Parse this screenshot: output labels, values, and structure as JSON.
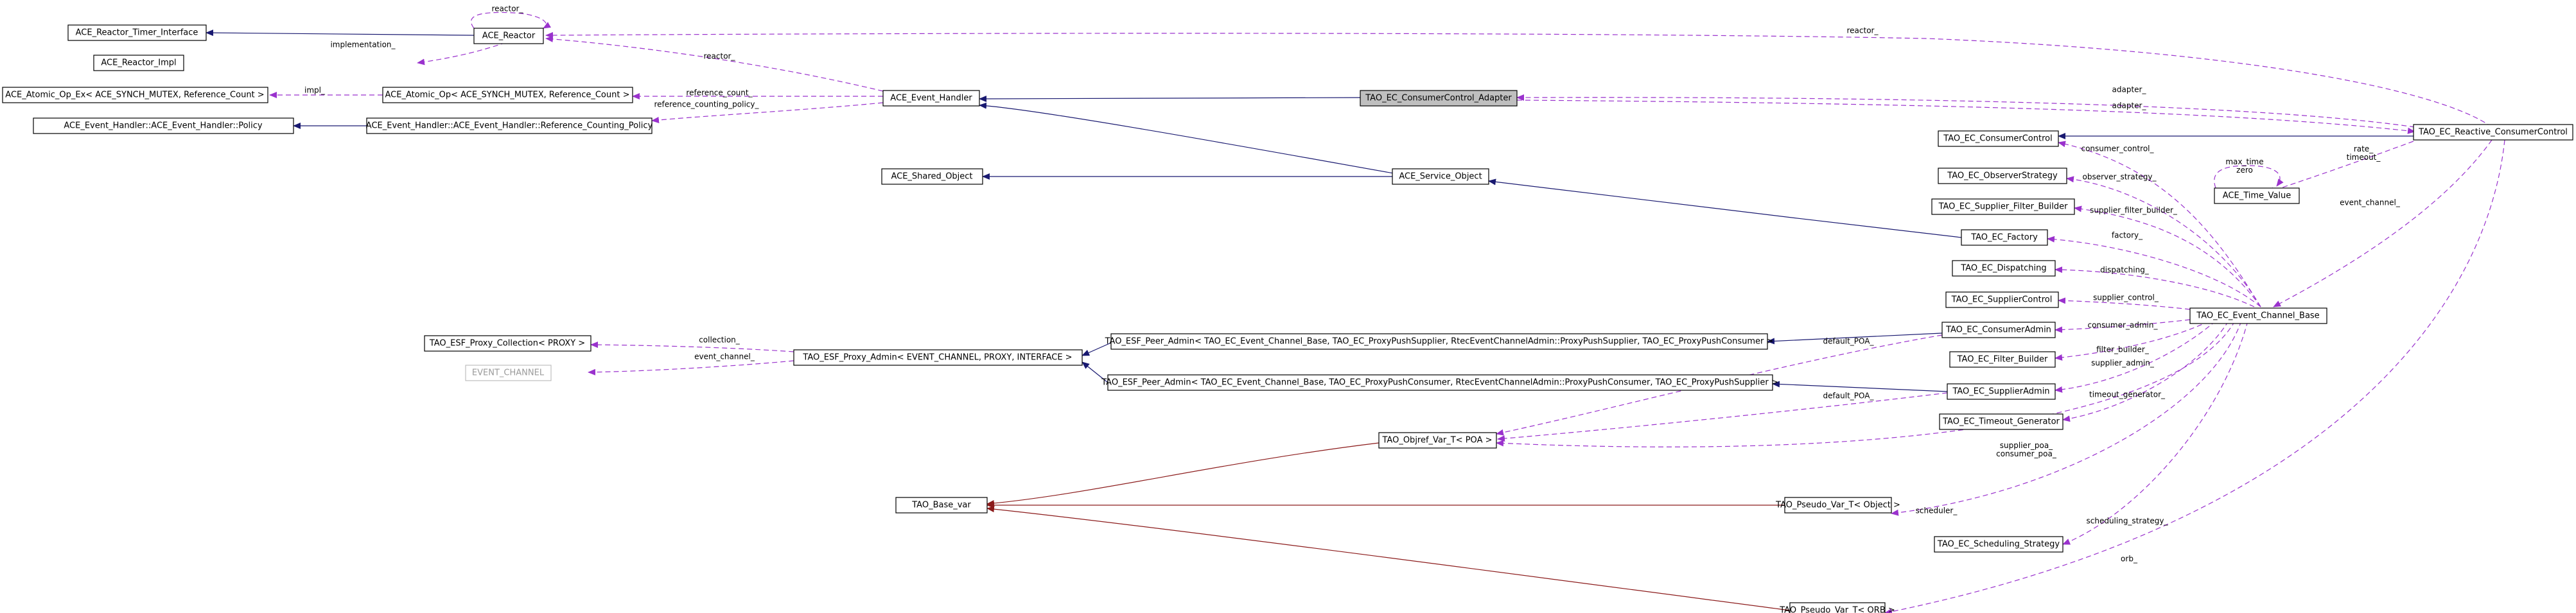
{
  "diagram": {
    "nodes": {
      "reactor_timer_interface": "ACE_Reactor_Timer_Interface",
      "reactor": "ACE_Reactor",
      "reactor_impl": "ACE_Reactor_Impl",
      "atomic_op_ex": "ACE_Atomic_Op_Ex< ACE_SYNCH_MUTEX, Reference_Count >",
      "atomic_op": "ACE_Atomic_Op< ACE_SYNCH_MUTEX, Reference_Count >",
      "event_handler": "ACE_Event_Handler",
      "consumer_control_adapter": "TAO_EC_ConsumerControl_Adapter",
      "policy": "ACE_Event_Handler::ACE_Event_Handler::Policy",
      "counting_policy": "ACE_Event_Handler::ACE_Event_Handler::Reference_Counting_Policy",
      "shared_object": "ACE_Shared_Object",
      "service_object": "ACE_Service_Object",
      "consumer_control": "TAO_EC_ConsumerControl",
      "reactive_consumer_control": "TAO_EC_Reactive_ConsumerControl",
      "time_value": "ACE_Time_Value",
      "observer_strategy": "TAO_EC_ObserverStrategy",
      "supplier_filter_builder": "TAO_EC_Supplier_Filter_Builder",
      "factory": "TAO_EC_Factory",
      "dispatching": "TAO_EC_Dispatching",
      "supplier_control": "TAO_EC_SupplierControl",
      "event_channel_base": "TAO_EC_Event_Channel_Base",
      "proxy_collection": "TAO_ESF_Proxy_Collection< PROXY >",
      "proxy_admin": "TAO_ESF_Proxy_Admin< EVENT_CHANNEL, PROXY, INTERFACE >",
      "peer_admin_supplier": "TAO_ESF_Peer_Admin< TAO_EC_Event_Channel_Base, TAO_EC_ProxyPushSupplier, RtecEventChannelAdmin::ProxyPushSupplier, TAO_EC_ProxyPushConsumer >",
      "consumer_admin": "TAO_EC_ConsumerAdmin",
      "event_channel": "EVENT_CHANNEL",
      "filter_builder": "TAO_EC_Filter_Builder",
      "peer_admin_consumer": "TAO_ESF_Peer_Admin< TAO_EC_Event_Channel_Base, TAO_EC_ProxyPushConsumer, RtecEventChannelAdmin::ProxyPushConsumer, TAO_EC_ProxyPushSupplier >",
      "supplier_admin": "TAO_EC_SupplierAdmin",
      "timeout_generator": "TAO_EC_Timeout_Generator",
      "objref_var": "TAO_Objref_Var_T< POA >",
      "base_var": "TAO_Base_var",
      "pseudo_var_object": "TAO_Pseudo_Var_T< Object >",
      "scheduling_strategy": "TAO_EC_Scheduling_Strategy",
      "pseudo_var_orb": "TAO_Pseudo_Var_T< ORB >"
    },
    "labels": {
      "reactor_self": "reactor_",
      "implementation": "implementation_",
      "reactor_eh": "reactor_",
      "impl": "impl_",
      "reference_count": "reference_count_",
      "counting_policy": "reference_counting_policy_",
      "reactor_rcc": "reactor_",
      "adapter_1": "adapter_",
      "adapter_2": "adapter_",
      "rate_timeout": "rate_\ntimeout_",
      "max_time_zero": "max_time\nzero",
      "consumer_control": "consumer_control_",
      "observer_strategy": "observer_strategy_",
      "event_channel_rcc": "event_channel_",
      "supplier_filter_builder": "supplier_filter_builder_",
      "factory": "factory_",
      "dispatching": "dispatching_",
      "supplier_control": "supplier_control_",
      "collection": "collection_",
      "event_channel_pa": "event_channel_",
      "consumer_admin": "consumer_admin_",
      "default_poa_1": "default_POA_",
      "filter_builder": "filter_builder_",
      "supplier_admin": "supplier_admin_",
      "default_poa_2": "default_POA_",
      "timeout_generator": "timeout_generator_",
      "supplier_poa": "supplier_poa_\nconsumer_poa_",
      "scheduler": "scheduler_",
      "scheduling_strategy": "scheduling_strategy_",
      "orb": "orb_"
    }
  }
}
